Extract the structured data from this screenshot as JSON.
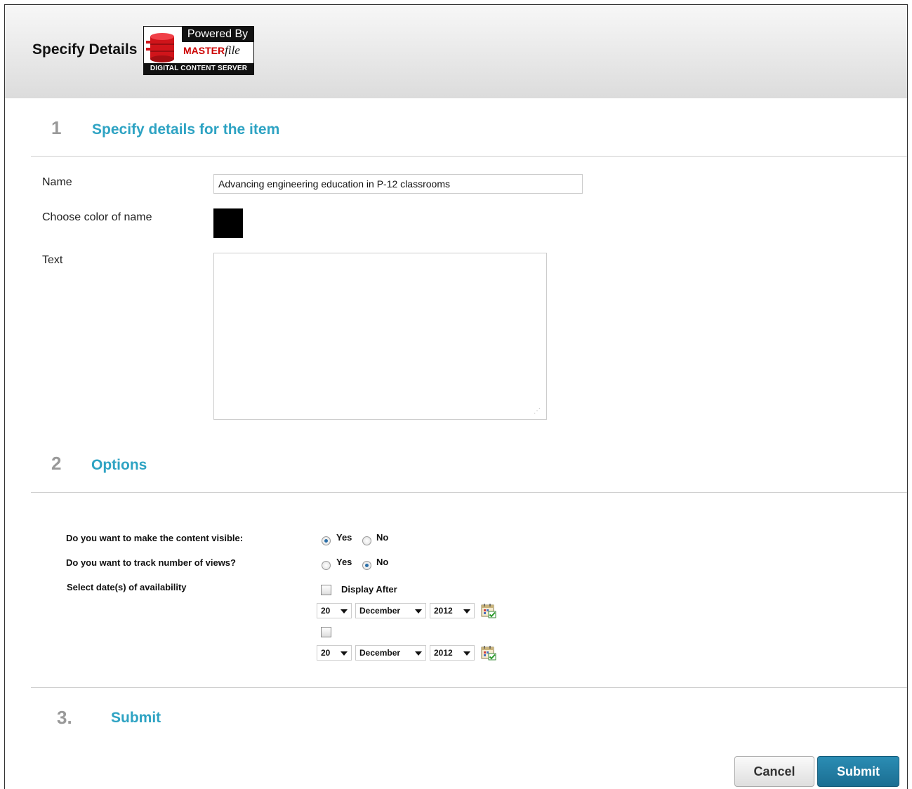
{
  "header": {
    "title": "Specify Details",
    "logo": {
      "powered_by": "Powered By",
      "brand_master": "MASTER",
      "brand_file": "file",
      "tagline": "DIGITAL CONTENT SERVER"
    }
  },
  "section1": {
    "number": "1",
    "title": "Specify details for the item",
    "name_label": "Name",
    "name_value": "Advancing engineering education in P-12 classrooms",
    "color_label": "Choose color of name",
    "color_value": "#000000",
    "text_label": "Text",
    "text_value": ""
  },
  "section2": {
    "number": "2",
    "title": "Options",
    "visible_question": "Do you want to make the content visible:",
    "visible_yes": "Yes",
    "visible_no": "No",
    "visible_selected": "Yes",
    "track_question": "Do you want to track number of views?",
    "track_yes": "Yes",
    "track_no": "No",
    "track_selected": "No",
    "dates_label": "Select date(s) of availability",
    "display_after_label": "Display After",
    "date1": {
      "day": "20",
      "month": "December",
      "year": "2012"
    },
    "date2": {
      "day": "20",
      "month": "December",
      "year": "2012"
    }
  },
  "section3": {
    "number": "3.",
    "title": "Submit"
  },
  "buttons": {
    "cancel": "Cancel",
    "submit": "Submit"
  },
  "colors": {
    "accent": "#2ea3c3",
    "submit_button": "#1f7ea6"
  }
}
